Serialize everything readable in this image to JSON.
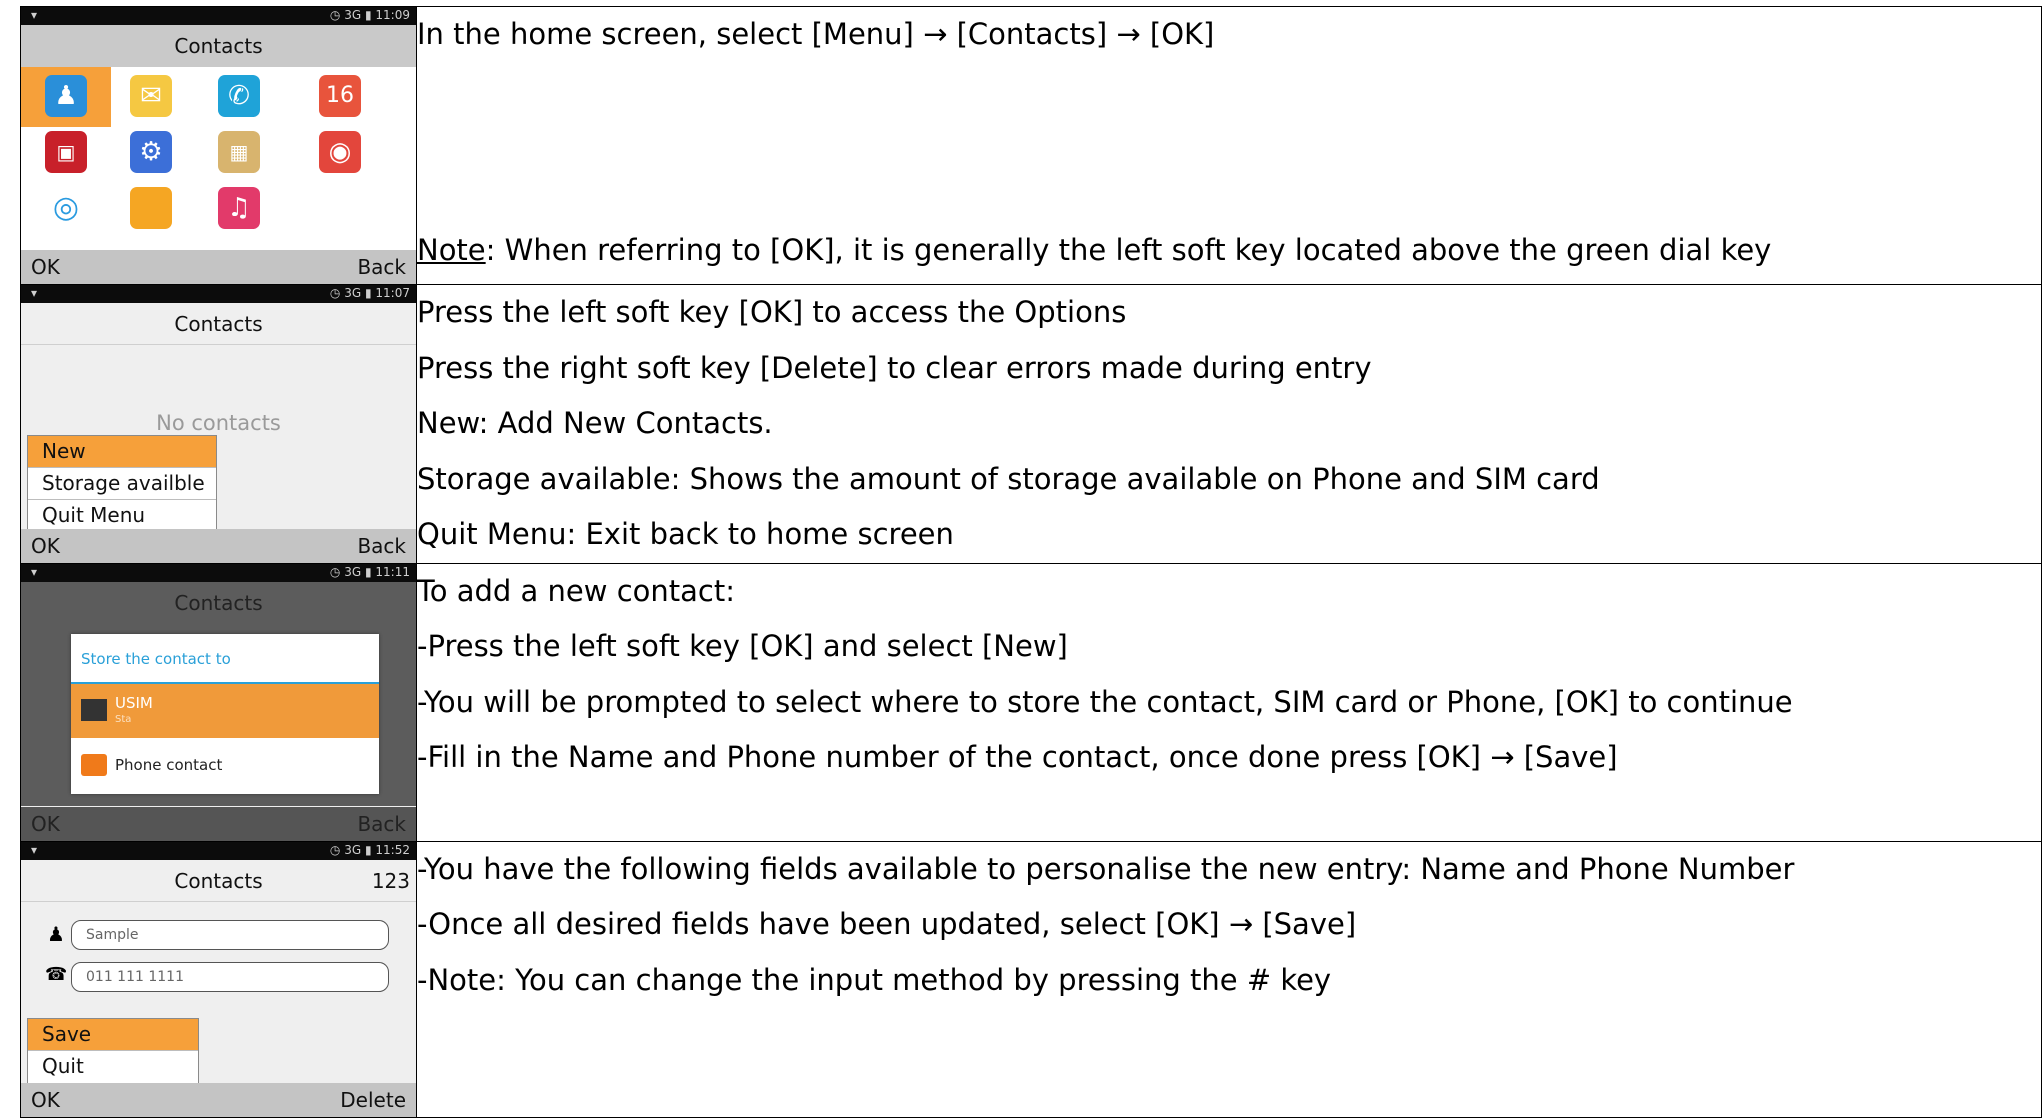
{
  "rows": [
    {
      "screen": {
        "status_time": "11:09",
        "status_net": "3G",
        "title": "Contacts",
        "left_key": "OK",
        "right_key": "Back"
      },
      "lines": [
        "In the home screen, select [Menu] → [Contacts] → [OK]"
      ],
      "note_label": "Note",
      "note_text": ": When referring to [OK], it is generally the left soft key located above the green dial key"
    },
    {
      "screen": {
        "status_time": "11:07",
        "status_net": "3G",
        "title": "Contacts",
        "empty_text": "No contacts",
        "menu": [
          "New",
          "Storage availble",
          "Quit Menu"
        ],
        "left_key": "OK",
        "right_key": "Back"
      },
      "lines": [
        "Press the left soft key [OK] to access the Options",
        "Press the right soft key [Delete] to clear errors made during entry",
        "New: Add New Contacts.",
        "Storage available: Shows the amount of storage available on Phone and SIM card",
        "Quit Menu: Exit back to home screen"
      ]
    },
    {
      "screen": {
        "status_time": "11:11",
        "status_net": "3G",
        "title": "Contacts",
        "dialog_title": "Store the contact to",
        "option1": "USIM",
        "option1_sub": "Sta",
        "option2": "Phone contact",
        "left_key": "OK",
        "right_key": "Back"
      },
      "lines": [
        "To add a new contact:",
        "-Press the left soft key [OK] and select [New]",
        "-You will be prompted to select where to store the contact, SIM card or Phone, [OK] to continue",
        "-Fill in the Name and Phone number of the contact, once done press [OK] → [Save]"
      ]
    },
    {
      "screen": {
        "status_time": "11:52",
        "status_net": "3G",
        "title": "Contacts",
        "input_mode": "123",
        "name_value": "Sample",
        "phone_value": "011 111 1111",
        "menu": [
          "Save",
          "Quit"
        ],
        "left_key": "OK",
        "right_key": "Delete"
      },
      "lines": [
        "-You have the following fields available to personalise the new entry: Name and Phone Number",
        "-Once all desired fields have been updated, select [OK] → [Save]",
        "-Note: You can change the input method by pressing the # key"
      ]
    }
  ],
  "colors": {
    "highlight": "#f6a03a",
    "dialog_accent": "#2aa0d8"
  }
}
